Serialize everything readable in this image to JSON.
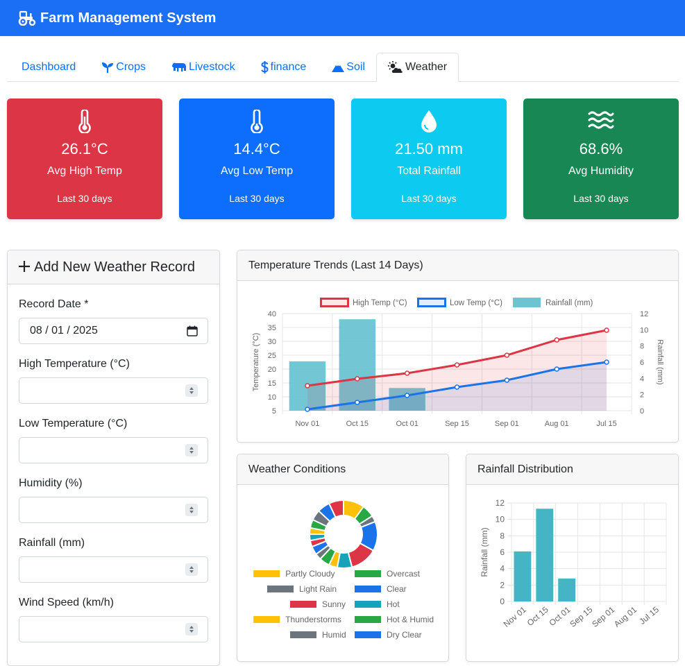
{
  "app": {
    "title": "Farm Management System"
  },
  "tabs": [
    {
      "label": "Dashboard",
      "icon": "none"
    },
    {
      "label": "Crops",
      "icon": "seedling-icon"
    },
    {
      "label": "Livestock",
      "icon": "cow-icon"
    },
    {
      "label": "finance",
      "icon": "dollar-icon"
    },
    {
      "label": "Soil",
      "icon": "mountain-icon"
    },
    {
      "label": "Weather",
      "icon": "cloud-sun-icon",
      "active": true
    }
  ],
  "stats": [
    {
      "value": "26.1°C",
      "label": "Avg High Temp",
      "sub": "Last 30 days",
      "color": "#dc3545",
      "icon": "thermometer-icon"
    },
    {
      "value": "14.4°C",
      "label": "Avg Low Temp",
      "sub": "Last 30 days",
      "color": "#0d6efd",
      "icon": "thermometer-icon"
    },
    {
      "value": "21.50 mm",
      "label": "Total Rainfall",
      "sub": "Last 30 days",
      "color": "#0dcaf0",
      "icon": "droplet-icon"
    },
    {
      "value": "68.6%",
      "label": "Avg Humidity",
      "sub": "Last 30 days",
      "color": "#198754",
      "icon": "water-icon"
    }
  ],
  "form": {
    "title": "Add New Weather Record",
    "fields": [
      {
        "label": "Record Date *",
        "value": "08 / 01 / 2025",
        "type": "date"
      },
      {
        "label": "High Temperature (°C)",
        "value": "",
        "type": "number"
      },
      {
        "label": "Low Temperature (°C)",
        "value": "",
        "type": "number"
      },
      {
        "label": "Humidity (%)",
        "value": "",
        "type": "number"
      },
      {
        "label": "Rainfall (mm)",
        "value": "",
        "type": "number"
      },
      {
        "label": "Wind Speed (km/h)",
        "value": "",
        "type": "number"
      }
    ]
  },
  "charts": {
    "trend_title": "Temperature Trends (Last 14 Days)",
    "conditions_title": "Weather Conditions",
    "rain_title": "Rainfall Distribution"
  },
  "chart_data": [
    {
      "type": "line",
      "title": "Temperature Trends (Last 14 Days)",
      "categories": [
        "Nov 01",
        "Oct 15",
        "Oct 01",
        "Sep 15",
        "Sep 01",
        "Aug 01",
        "Jul 15"
      ],
      "series": [
        {
          "name": "High Temp (°C)",
          "type": "line",
          "axis": "left",
          "color": "#dc3545",
          "values": [
            14,
            16.5,
            18.5,
            21.5,
            25,
            30.5,
            34
          ]
        },
        {
          "name": "Low Temp (°C)",
          "type": "line",
          "axis": "left",
          "color": "#1a73e8",
          "values": [
            5.5,
            8,
            10.5,
            13.5,
            16,
            20,
            22.5
          ]
        },
        {
          "name": "Rainfall (mm)",
          "type": "bar",
          "axis": "right",
          "color": "#6cc4d2",
          "values": [
            6.1,
            11.3,
            2.8,
            0,
            0,
            0,
            0
          ]
        }
      ],
      "ylabel": "Temperature (°C)",
      "ylim": [
        5,
        40
      ],
      "yticks": [
        5,
        10,
        15,
        20,
        25,
        30,
        35,
        40
      ],
      "y2label": "Rainfall (mm)",
      "y2lim": [
        0,
        12
      ],
      "y2ticks": [
        0,
        2,
        4,
        6,
        8,
        10,
        12
      ],
      "legend": "top",
      "grid": true
    },
    {
      "type": "pie",
      "title": "Weather Conditions",
      "categories": [
        "Partly Cloudy",
        "Overcast",
        "Light Rain",
        "Clear",
        "Sunny",
        "Hot",
        "Thunderstorms",
        "Hot & Humid",
        "Humid",
        "Dry Clear"
      ],
      "segment_colors": [
        "#ffc107",
        "#28a745",
        "#6c757d",
        "#1a73e8",
        "#dc3545",
        "#17a2b8"
      ],
      "values": [
        10,
        6,
        3,
        14,
        13,
        7,
        4,
        5,
        3,
        4,
        3,
        3,
        3,
        4,
        5,
        6,
        7
      ],
      "legend": "bottom"
    },
    {
      "type": "bar",
      "title": "Rainfall Distribution",
      "categories": [
        "Nov 01",
        "Oct 15",
        "Oct 01",
        "Sep 15",
        "Sep 01",
        "Aug 01",
        "Jul 15"
      ],
      "values": [
        6.1,
        11.3,
        2.8,
        0,
        0,
        0,
        0
      ],
      "ylabel": "Rainfall (mm)",
      "ylim": [
        0,
        12
      ],
      "yticks": [
        0,
        2,
        4,
        6,
        8,
        10,
        12
      ],
      "color": "#45b5c6",
      "grid": true
    }
  ]
}
